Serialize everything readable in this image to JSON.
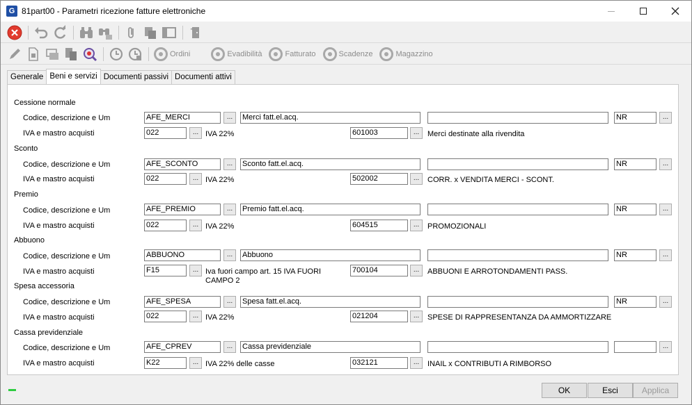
{
  "window": {
    "title": "81part00 - Parametri ricezione fatture elettroniche",
    "app_icon": "G"
  },
  "toolbar2": {
    "ordini": "Ordini",
    "evadibilita": "Evadibilità",
    "fatturato": "Fatturato",
    "scadenze": "Scadenze",
    "magazzino": "Magazzino"
  },
  "tabs": [
    "Generale",
    "Beni e servizi",
    "Documenti passivi",
    "Documenti attivi"
  ],
  "labels": {
    "codice": "Codice, descrizione e Um",
    "iva": "IVA e mastro acquisti",
    "dots": "..."
  },
  "sections": [
    {
      "title": "Cessione normale",
      "codice": "AFE_MERCI",
      "descrizione": "Merci fatt.el.acq.",
      "extra": "",
      "um": "NR",
      "iva": "022",
      "iva_desc": "IVA 22%",
      "mastro": "601003",
      "mastro_desc": "Merci destinate alla rivendita"
    },
    {
      "title": "Sconto",
      "codice": "AFE_SCONTO",
      "descrizione": "Sconto fatt.el.acq.",
      "extra": "",
      "um": "NR",
      "iva": "022",
      "iva_desc": "IVA 22%",
      "mastro": "502002",
      "mastro_desc": "CORR. x VENDITA MERCI - SCONT."
    },
    {
      "title": "Premio",
      "codice": "AFE_PREMIO",
      "descrizione": "Premio fatt.el.acq.",
      "extra": "",
      "um": "NR",
      "iva": "022",
      "iva_desc": "IVA 22%",
      "mastro": "604515",
      "mastro_desc": "PROMOZIONALI"
    },
    {
      "title": "Abbuono",
      "codice": "ABBUONO",
      "descrizione": "Abbuono",
      "extra": "",
      "um": "NR",
      "iva": "F15",
      "iva_desc": "Iva fuori campo art. 15 IVA FUORI CAMPO 2",
      "mastro": "700104",
      "mastro_desc": "ABBUONI E ARROTONDAMENTI PASS."
    },
    {
      "title": "Spesa accessoria",
      "codice": "AFE_SPESA",
      "descrizione": "Spesa fatt.el.acq.",
      "extra": "",
      "um": "NR",
      "iva": "022",
      "iva_desc": "IVA 22%",
      "mastro": "021204",
      "mastro_desc": "SPESE DI RAPPRESENTANZA DA AMMORTIZZARE"
    },
    {
      "title": "Cassa previdenziale",
      "codice": "AFE_CPREV",
      "descrizione": "Cassa previdenziale",
      "extra": "",
      "um": "",
      "iva": "K22",
      "iva_desc": "IVA 22% delle casse",
      "mastro": "032121",
      "mastro_desc": "INAIL x CONTRIBUTI A RIMBORSO"
    }
  ],
  "buttons": {
    "ok": "OK",
    "esci": "Esci",
    "applica": "Applica"
  },
  "colors": {
    "status_led": "#2ecc40",
    "close_red": "#e23b2e"
  }
}
